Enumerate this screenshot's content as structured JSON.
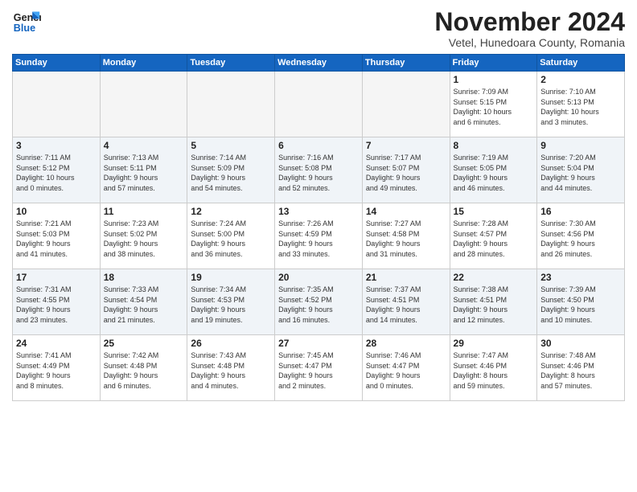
{
  "logo": {
    "line1": "General",
    "line2": "Blue"
  },
  "title": "November 2024",
  "subtitle": "Vetel, Hunedoara County, Romania",
  "weekdays": [
    "Sunday",
    "Monday",
    "Tuesday",
    "Wednesday",
    "Thursday",
    "Friday",
    "Saturday"
  ],
  "weeks": [
    [
      {
        "day": "",
        "info": ""
      },
      {
        "day": "",
        "info": ""
      },
      {
        "day": "",
        "info": ""
      },
      {
        "day": "",
        "info": ""
      },
      {
        "day": "",
        "info": ""
      },
      {
        "day": "1",
        "info": "Sunrise: 7:09 AM\nSunset: 5:15 PM\nDaylight: 10 hours\nand 6 minutes."
      },
      {
        "day": "2",
        "info": "Sunrise: 7:10 AM\nSunset: 5:13 PM\nDaylight: 10 hours\nand 3 minutes."
      }
    ],
    [
      {
        "day": "3",
        "info": "Sunrise: 7:11 AM\nSunset: 5:12 PM\nDaylight: 10 hours\nand 0 minutes."
      },
      {
        "day": "4",
        "info": "Sunrise: 7:13 AM\nSunset: 5:11 PM\nDaylight: 9 hours\nand 57 minutes."
      },
      {
        "day": "5",
        "info": "Sunrise: 7:14 AM\nSunset: 5:09 PM\nDaylight: 9 hours\nand 54 minutes."
      },
      {
        "day": "6",
        "info": "Sunrise: 7:16 AM\nSunset: 5:08 PM\nDaylight: 9 hours\nand 52 minutes."
      },
      {
        "day": "7",
        "info": "Sunrise: 7:17 AM\nSunset: 5:07 PM\nDaylight: 9 hours\nand 49 minutes."
      },
      {
        "day": "8",
        "info": "Sunrise: 7:19 AM\nSunset: 5:05 PM\nDaylight: 9 hours\nand 46 minutes."
      },
      {
        "day": "9",
        "info": "Sunrise: 7:20 AM\nSunset: 5:04 PM\nDaylight: 9 hours\nand 44 minutes."
      }
    ],
    [
      {
        "day": "10",
        "info": "Sunrise: 7:21 AM\nSunset: 5:03 PM\nDaylight: 9 hours\nand 41 minutes."
      },
      {
        "day": "11",
        "info": "Sunrise: 7:23 AM\nSunset: 5:02 PM\nDaylight: 9 hours\nand 38 minutes."
      },
      {
        "day": "12",
        "info": "Sunrise: 7:24 AM\nSunset: 5:00 PM\nDaylight: 9 hours\nand 36 minutes."
      },
      {
        "day": "13",
        "info": "Sunrise: 7:26 AM\nSunset: 4:59 PM\nDaylight: 9 hours\nand 33 minutes."
      },
      {
        "day": "14",
        "info": "Sunrise: 7:27 AM\nSunset: 4:58 PM\nDaylight: 9 hours\nand 31 minutes."
      },
      {
        "day": "15",
        "info": "Sunrise: 7:28 AM\nSunset: 4:57 PM\nDaylight: 9 hours\nand 28 minutes."
      },
      {
        "day": "16",
        "info": "Sunrise: 7:30 AM\nSunset: 4:56 PM\nDaylight: 9 hours\nand 26 minutes."
      }
    ],
    [
      {
        "day": "17",
        "info": "Sunrise: 7:31 AM\nSunset: 4:55 PM\nDaylight: 9 hours\nand 23 minutes."
      },
      {
        "day": "18",
        "info": "Sunrise: 7:33 AM\nSunset: 4:54 PM\nDaylight: 9 hours\nand 21 minutes."
      },
      {
        "day": "19",
        "info": "Sunrise: 7:34 AM\nSunset: 4:53 PM\nDaylight: 9 hours\nand 19 minutes."
      },
      {
        "day": "20",
        "info": "Sunrise: 7:35 AM\nSunset: 4:52 PM\nDaylight: 9 hours\nand 16 minutes."
      },
      {
        "day": "21",
        "info": "Sunrise: 7:37 AM\nSunset: 4:51 PM\nDaylight: 9 hours\nand 14 minutes."
      },
      {
        "day": "22",
        "info": "Sunrise: 7:38 AM\nSunset: 4:51 PM\nDaylight: 9 hours\nand 12 minutes."
      },
      {
        "day": "23",
        "info": "Sunrise: 7:39 AM\nSunset: 4:50 PM\nDaylight: 9 hours\nand 10 minutes."
      }
    ],
    [
      {
        "day": "24",
        "info": "Sunrise: 7:41 AM\nSunset: 4:49 PM\nDaylight: 9 hours\nand 8 minutes."
      },
      {
        "day": "25",
        "info": "Sunrise: 7:42 AM\nSunset: 4:48 PM\nDaylight: 9 hours\nand 6 minutes."
      },
      {
        "day": "26",
        "info": "Sunrise: 7:43 AM\nSunset: 4:48 PM\nDaylight: 9 hours\nand 4 minutes."
      },
      {
        "day": "27",
        "info": "Sunrise: 7:45 AM\nSunset: 4:47 PM\nDaylight: 9 hours\nand 2 minutes."
      },
      {
        "day": "28",
        "info": "Sunrise: 7:46 AM\nSunset: 4:47 PM\nDaylight: 9 hours\nand 0 minutes."
      },
      {
        "day": "29",
        "info": "Sunrise: 7:47 AM\nSunset: 4:46 PM\nDaylight: 8 hours\nand 59 minutes."
      },
      {
        "day": "30",
        "info": "Sunrise: 7:48 AM\nSunset: 4:46 PM\nDaylight: 8 hours\nand 57 minutes."
      }
    ]
  ]
}
